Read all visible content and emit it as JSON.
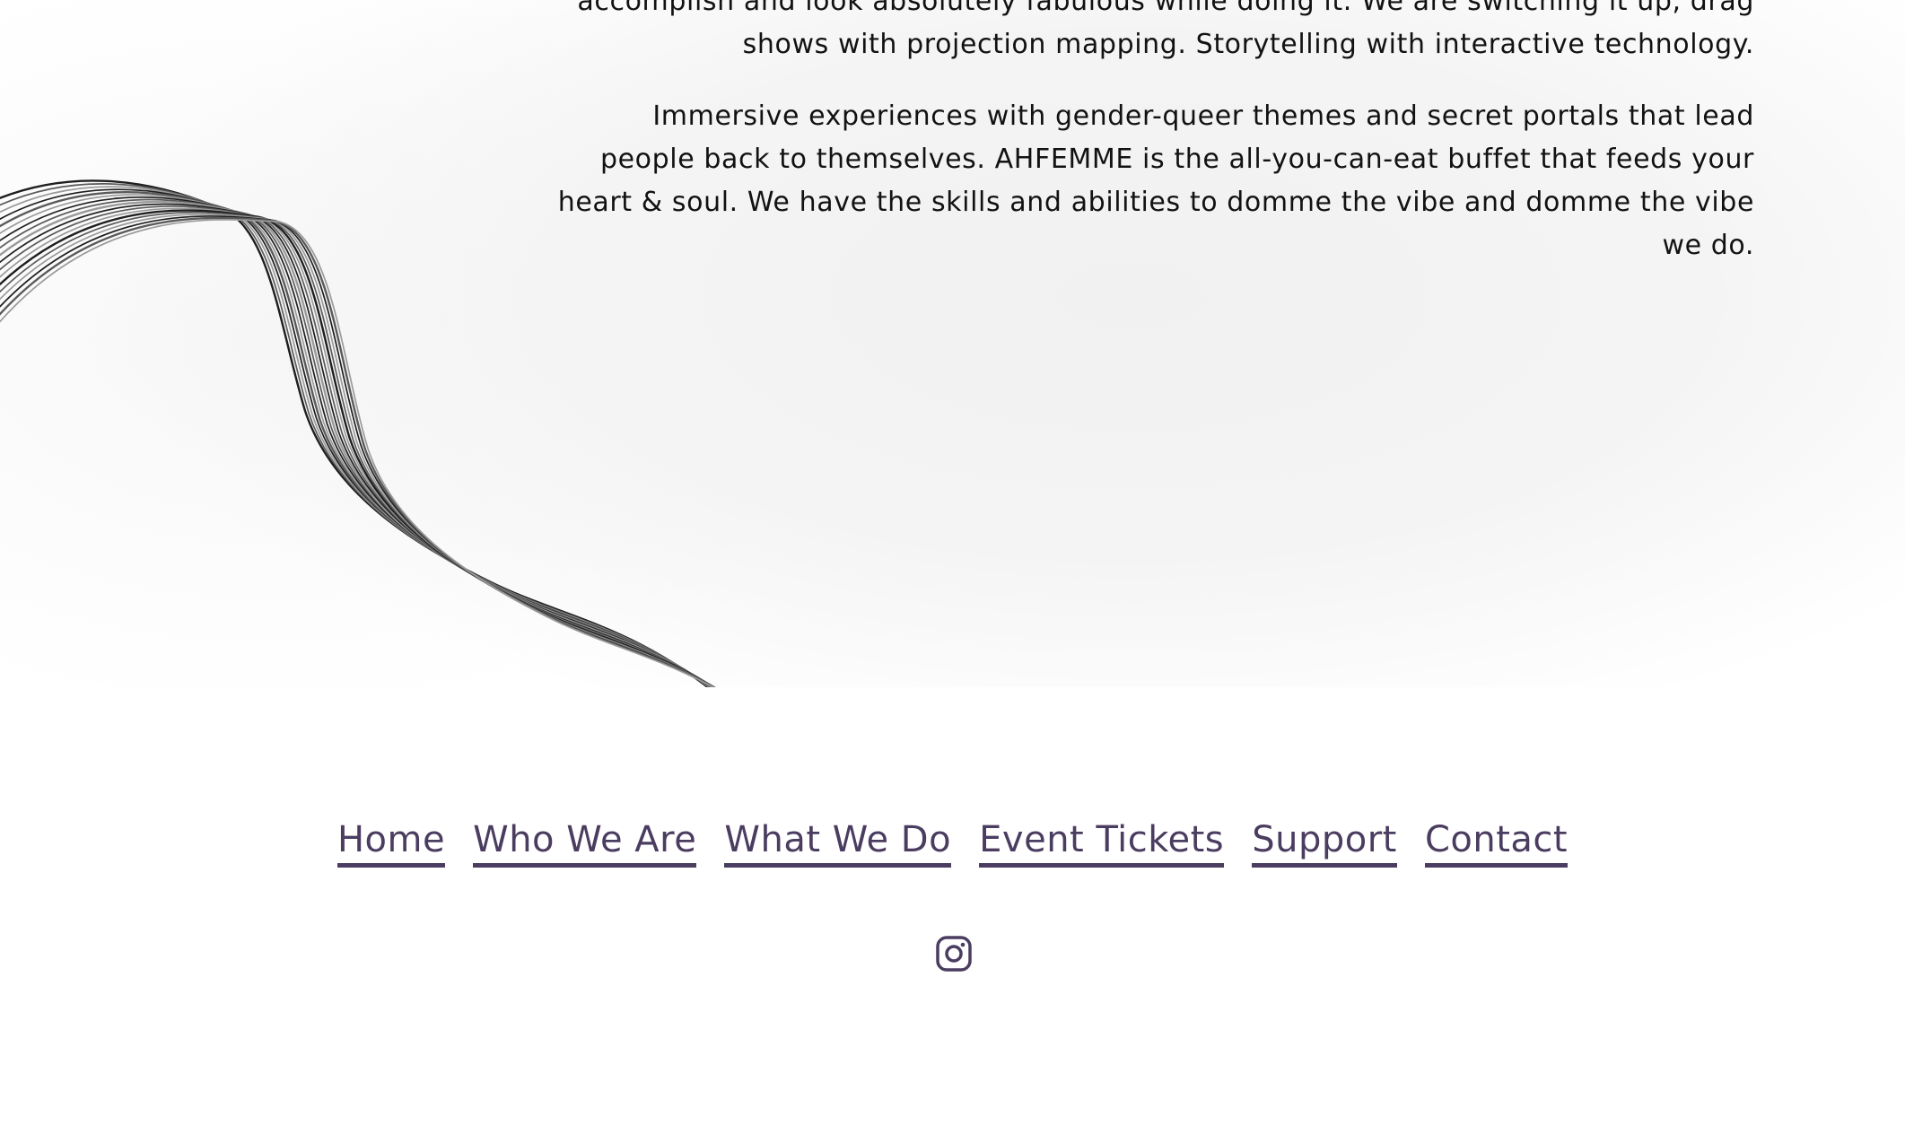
{
  "about": {
    "paragraph1_line1": "accomplish and look absolutely fabulous while doing it. We are switching it up, drag",
    "paragraph1_line2": "shows with projection mapping. Storytelling with interactive technology.",
    "paragraph2": "Immersive experiences with gender-queer themes and secret portals that lead people back to themselves. AHFEMME is the all-you-can-eat buffet that feeds your heart & soul. We have the skills and abilities to domme the vibe and domme the vibe we do."
  },
  "footer": {
    "nav": [
      {
        "label": "Home"
      },
      {
        "label": "Who We Are"
      },
      {
        "label": "What We Do"
      },
      {
        "label": "Event Tickets"
      },
      {
        "label": "Support"
      },
      {
        "label": "Contact"
      }
    ],
    "social_icon": "instagram-icon"
  },
  "colors": {
    "link": "#4a3d60",
    "text": "#121212",
    "wave_lines": "#3a3a3a"
  }
}
